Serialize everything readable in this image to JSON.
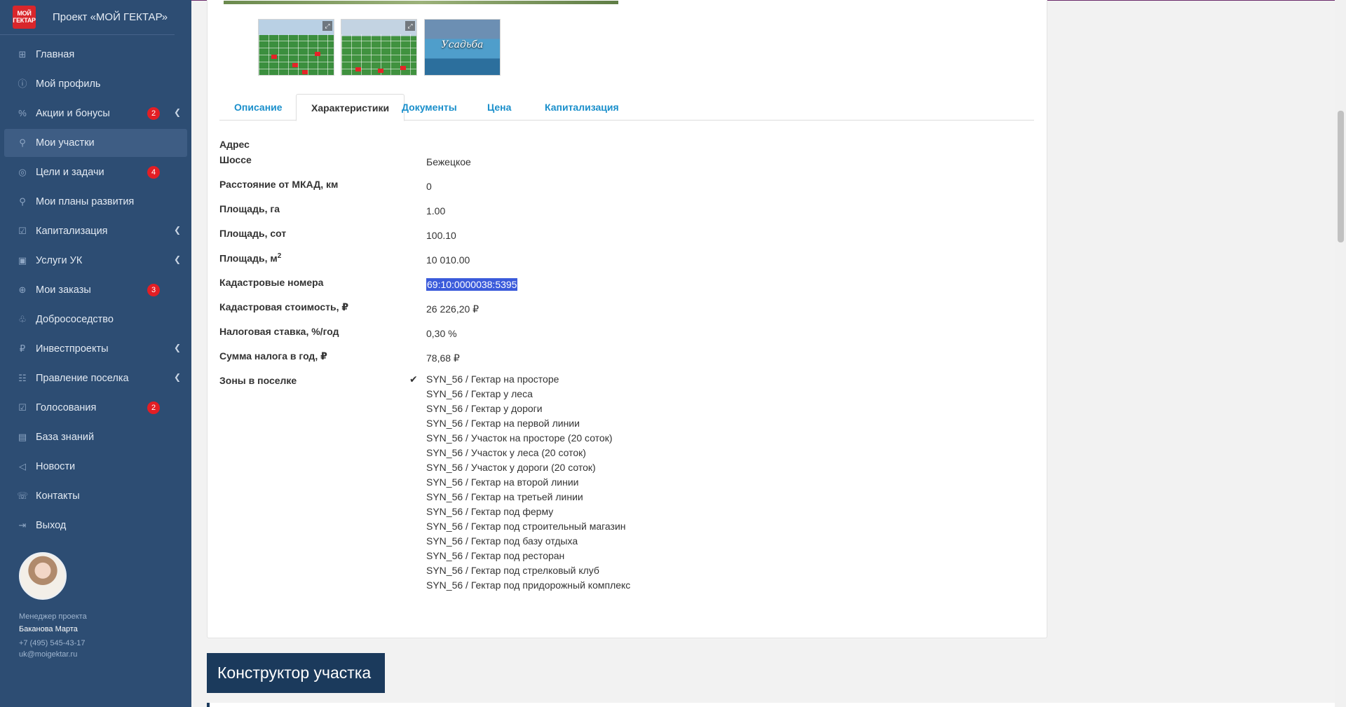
{
  "sidebar": {
    "logo_text": "МОЙ ГЕКТАР",
    "title": "Проект «МОЙ ГЕКТАР»",
    "items": [
      {
        "label": "Главная",
        "icon": "grid-icon",
        "badge": "",
        "chevron": false,
        "active": false
      },
      {
        "label": "Мой профиль",
        "icon": "info-icon",
        "badge": "",
        "chevron": false,
        "active": false
      },
      {
        "label": "Акции и бонусы",
        "icon": "percent-icon",
        "badge": "2",
        "chevron": true,
        "active": false
      },
      {
        "label": "Мои участки",
        "icon": "map-pin-icon",
        "badge": "",
        "chevron": false,
        "active": true
      },
      {
        "label": "Цели и задачи",
        "icon": "target-icon",
        "badge": "4",
        "chevron": false,
        "active": false
      },
      {
        "label": "Мои планы развития",
        "icon": "map-pin-icon",
        "badge": "",
        "chevron": false,
        "active": false
      },
      {
        "label": "Капитализация",
        "icon": "check-square-icon",
        "badge": "",
        "chevron": true,
        "active": false
      },
      {
        "label": "Услуги УК",
        "icon": "shopping-bag-icon",
        "badge": "",
        "chevron": true,
        "active": false
      },
      {
        "label": "Мои заказы",
        "icon": "cart-icon",
        "badge": "3",
        "chevron": false,
        "active": false
      },
      {
        "label": "Добрососедство",
        "icon": "handshake-icon",
        "badge": "",
        "chevron": false,
        "active": false
      },
      {
        "label": "Инвестпроекты",
        "icon": "ruble-icon",
        "badge": "",
        "chevron": true,
        "active": false
      },
      {
        "label": "Правление поселка",
        "icon": "users-icon",
        "badge": "",
        "chevron": true,
        "active": false
      },
      {
        "label": "Голосования",
        "icon": "check-square-icon",
        "badge": "2",
        "chevron": false,
        "active": false
      },
      {
        "label": "База знаний",
        "icon": "book-icon",
        "badge": "",
        "chevron": false,
        "active": false
      },
      {
        "label": "Новости",
        "icon": "megaphone-icon",
        "badge": "",
        "chevron": false,
        "active": false
      },
      {
        "label": "Контакты",
        "icon": "phone-icon",
        "badge": "",
        "chevron": false,
        "active": false
      },
      {
        "label": "Выход",
        "icon": "logout-icon",
        "badge": "",
        "chevron": false,
        "active": false
      }
    ],
    "manager": {
      "role": "Менеджер проекта",
      "name": "Баканова Марта",
      "phone": "+7 (495) 545-43-17",
      "email": "uk@moigektar.ru"
    }
  },
  "gallery": {
    "thumbs": [
      {
        "name": "thumbnail-aerial-plots-1",
        "text": ""
      },
      {
        "name": "thumbnail-aerial-plots-2",
        "text": ""
      },
      {
        "name": "thumbnail-usadba",
        "text": "Усадьба"
      }
    ]
  },
  "tabs": [
    {
      "label": "Описание",
      "active": false
    },
    {
      "label": "Характеристики",
      "active": true
    },
    {
      "label": "Документы",
      "active": false
    },
    {
      "label": "Цена",
      "active": false
    },
    {
      "label": "Капитализация",
      "active": false
    }
  ],
  "properties": {
    "address_label": "Адрес",
    "highway_label": "Шоссе",
    "highway_value": "Бежецкое",
    "distance_label": "Расстояние от МКАД, км",
    "distance_value": "0",
    "area_ha_label": "Площадь, га",
    "area_ha_value": "1.00",
    "area_sot_label": "Площадь, сот",
    "area_sot_value": "100.10",
    "area_m2_label": "Площадь, м",
    "area_m2_sup": "2",
    "area_m2_value": "10 010.00",
    "cadastral_label": "Кадастровые номера",
    "cadastral_value": "69:10:0000038:5395",
    "cadastral_cost_label": "Кадастровая стоимость, ₽",
    "cadastral_cost_value": "26 226,20 ₽",
    "tax_rate_label": "Налоговая ставка, %/год",
    "tax_rate_value": "0,30 %",
    "tax_sum_label": "Сумма налога в год, ₽",
    "tax_sum_value": "78,68 ₽",
    "zones_label": "Зоны в поселке"
  },
  "zones": [
    "SYN_56 / Гектар на просторе",
    "SYN_56 / Гектар у леса",
    "SYN_56 / Гектар у дороги",
    "SYN_56 / Гектар на первой линии",
    "SYN_56 / Участок на просторе (20 соток)",
    "SYN_56 / Участок у леса (20 соток)",
    "SYN_56 / Участок у дороги (20 соток)",
    "SYN_56 / Гектар на второй линии",
    "SYN_56 / Гектар на третьей линии",
    "SYN_56 / Гектар под ферму",
    "SYN_56 / Гектар под строительный магазин",
    "SYN_56 / Гектар под базу отдыха",
    "SYN_56 / Гектар под ресторан",
    "SYN_56 / Гектар под стрелковый клуб",
    "SYN_56 / Гектар под придорожный комплекс"
  ],
  "constructor_title": "Конструктор участка",
  "colors": {
    "sidebar_bg": "#2d4d73",
    "accent_link": "#1a8fcb",
    "badge": "#e31e24",
    "heading_bg": "#1b3a5c",
    "selection": "#3b5bdb"
  }
}
